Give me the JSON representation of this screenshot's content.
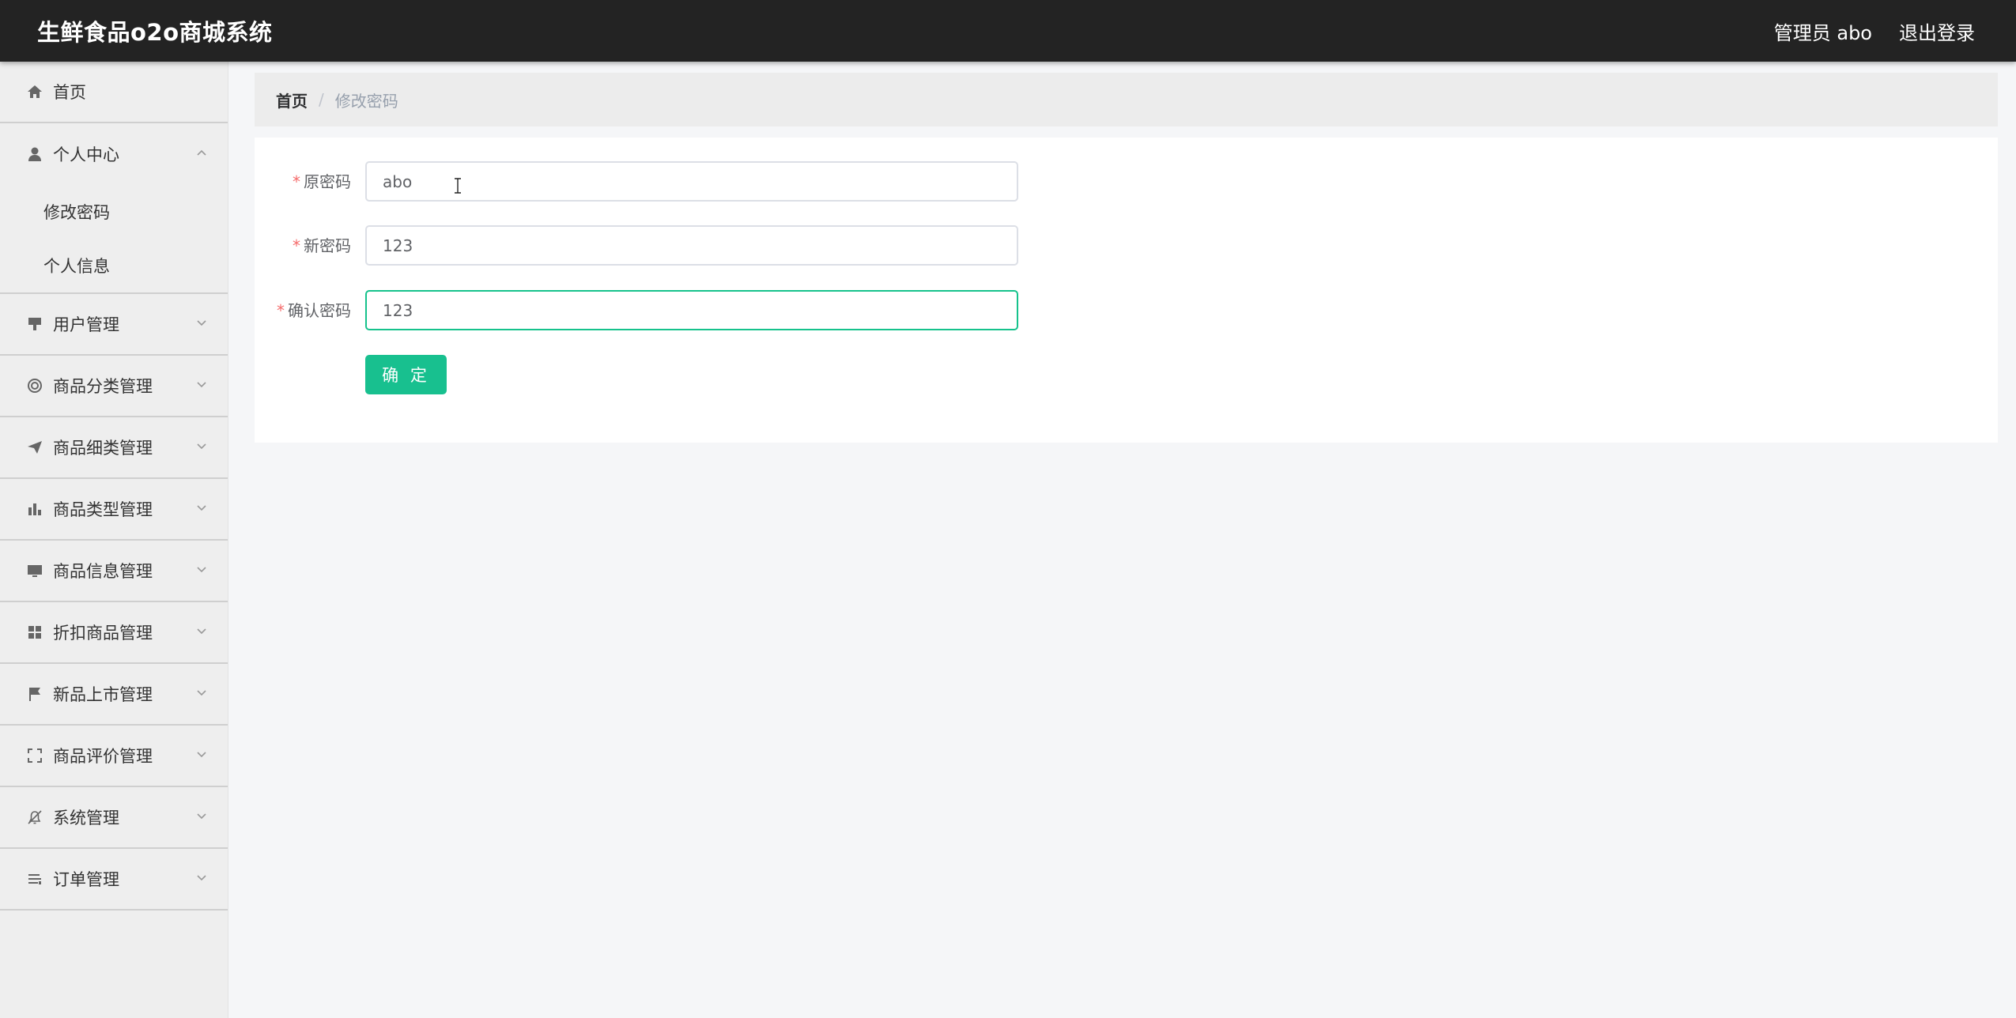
{
  "header": {
    "title": "生鲜食品o2o商城系统",
    "user_label": "管理员 abo",
    "logout_label": "退出登录"
  },
  "sidebar": {
    "items": [
      {
        "label": "首页",
        "icon": "home-icon"
      },
      {
        "label": "个人中心",
        "icon": "user-icon",
        "expanded": true,
        "children": [
          {
            "label": "修改密码"
          },
          {
            "label": "个人信息"
          }
        ]
      },
      {
        "label": "用户管理",
        "icon": "brush-icon"
      },
      {
        "label": "商品分类管理",
        "icon": "lifebuoy-icon"
      },
      {
        "label": "商品细类管理",
        "icon": "paper-plane-icon"
      },
      {
        "label": "商品类型管理",
        "icon": "bar-chart-icon"
      },
      {
        "label": "商品信息管理",
        "icon": "monitor-icon"
      },
      {
        "label": "折扣商品管理",
        "icon": "grid-icon"
      },
      {
        "label": "新品上市管理",
        "icon": "flag-icon"
      },
      {
        "label": "商品评价管理",
        "icon": "fullscreen-icon"
      },
      {
        "label": "系统管理",
        "icon": "bell-off-icon"
      },
      {
        "label": "订单管理",
        "icon": "sliders-icon"
      }
    ]
  },
  "breadcrumb": {
    "home": "首页",
    "separator": "/",
    "current": "修改密码"
  },
  "form": {
    "fields": [
      {
        "label": "原密码",
        "value": "abo",
        "required": true
      },
      {
        "label": "新密码",
        "value": "123",
        "required": true
      },
      {
        "label": "确认密码",
        "value": "123",
        "required": true,
        "focused": true
      }
    ],
    "submit_label": "确 定"
  },
  "colors": {
    "header_bg": "#232323",
    "accent": "#18c08f",
    "required": "#f56c6c",
    "sidebar_bg": "#eeeeee"
  }
}
